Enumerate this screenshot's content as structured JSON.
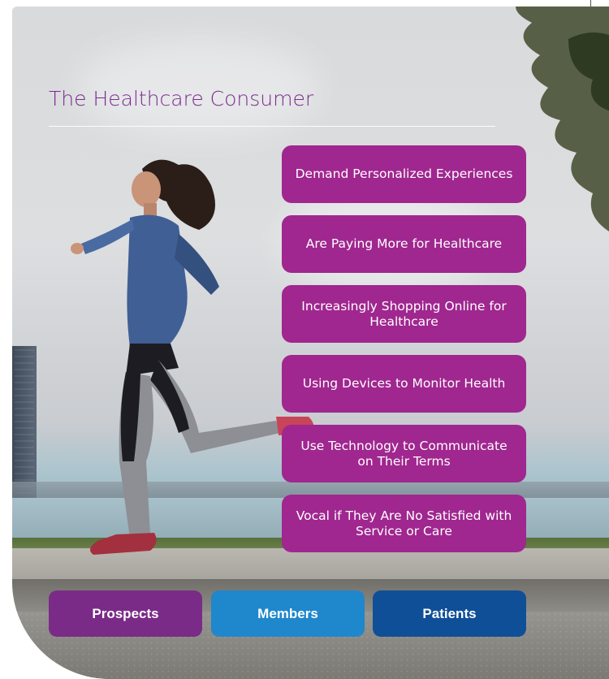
{
  "title": "The Healthcare Consumer",
  "traits": [
    {
      "label": "Demand Personalized Experiences"
    },
    {
      "label": "Are Paying More for Healthcare"
    },
    {
      "label": "Increasingly Shopping Online for Healthcare"
    },
    {
      "label": "Using Devices to Monitor Health"
    },
    {
      "label": "Use Technology to Communicate on Their Terms"
    },
    {
      "label": "Vocal if They Are No Satisfied with Service or Care"
    }
  ],
  "audiences": [
    {
      "label": "Prospects",
      "color": "#7a2b87"
    },
    {
      "label": "Members",
      "color": "#1f87cc"
    },
    {
      "label": "Patients",
      "color": "#0f4f98"
    }
  ],
  "colors": {
    "title": "#7b2c8e",
    "trait_pill": "#a0278f"
  },
  "image": {
    "subject": "woman-running-icon"
  }
}
